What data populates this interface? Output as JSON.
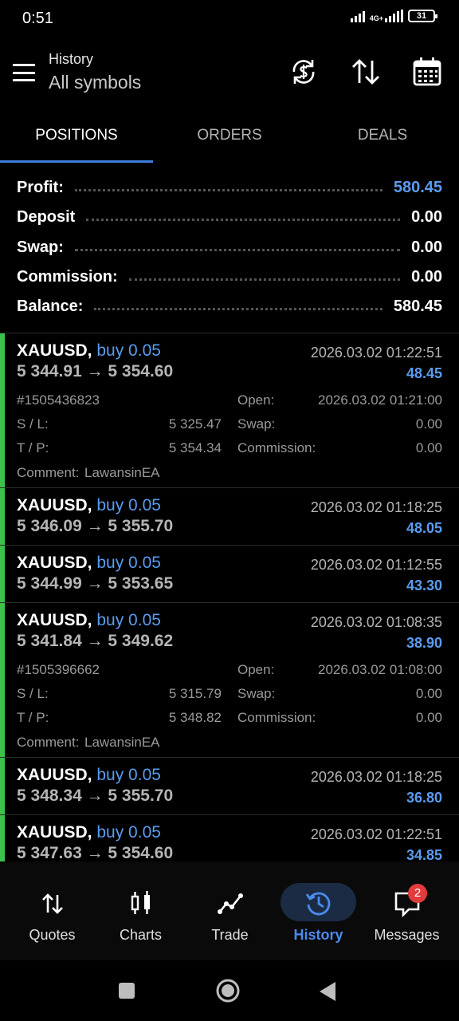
{
  "status": {
    "time": "0:51",
    "network": "4G+",
    "battery": "31"
  },
  "header": {
    "title": "History",
    "subtitle": "All symbols"
  },
  "tabs": [
    {
      "label": "POSITIONS"
    },
    {
      "label": "ORDERS"
    },
    {
      "label": "DEALS"
    }
  ],
  "summary": [
    {
      "label": "Profit:",
      "value": "580.45"
    },
    {
      "label": "Deposit",
      "value": "0.00"
    },
    {
      "label": "Swap:",
      "value": "0.00"
    },
    {
      "label": "Commission:",
      "value": "0.00"
    },
    {
      "label": "Balance:",
      "value": "580.45"
    }
  ],
  "positions": [
    {
      "symbol": "XAUUSD,",
      "side": "buy 0.05",
      "prices": "5 344.91 → 5 354.60",
      "time": "2026.03.02 01:22:51",
      "profit": "48.45",
      "ticket": "#1505436823",
      "open_label": "Open:",
      "open": "2026.03.02 01:21:00",
      "sl_label": "S / L:",
      "sl": "5 325.47",
      "swap_label": "Swap:",
      "swap": "0.00",
      "tp_label": "T / P:",
      "tp": "5 354.34",
      "commission_label": "Commission:",
      "commission": "0.00",
      "comment_label": "Comment:",
      "comment": "LawansinEA"
    },
    {
      "symbol": "XAUUSD,",
      "side": "buy 0.05",
      "prices": "5 346.09 → 5 355.70",
      "time": "2026.03.02 01:18:25",
      "profit": "48.05"
    },
    {
      "symbol": "XAUUSD,",
      "side": "buy 0.05",
      "prices": "5 344.99 → 5 353.65",
      "time": "2026.03.02 01:12:55",
      "profit": "43.30"
    },
    {
      "symbol": "XAUUSD,",
      "side": "buy 0.05",
      "prices": "5 341.84 → 5 349.62",
      "time": "2026.03.02 01:08:35",
      "profit": "38.90",
      "ticket": "#1505396662",
      "open_label": "Open:",
      "open": "2026.03.02 01:08:00",
      "sl_label": "S / L:",
      "sl": "5 315.79",
      "swap_label": "Swap:",
      "swap": "0.00",
      "tp_label": "T / P:",
      "tp": "5 348.82",
      "commission_label": "Commission:",
      "commission": "0.00",
      "comment_label": "Comment:",
      "comment": "LawansinEA"
    },
    {
      "symbol": "XAUUSD,",
      "side": "buy 0.05",
      "prices": "5 348.34 → 5 355.70",
      "time": "2026.03.02 01:18:25",
      "profit": "36.80"
    },
    {
      "symbol": "XAUUSD,",
      "side": "buy 0.05",
      "prices": "5 347.63 → 5 354.60",
      "time": "2026.03.02 01:22:51",
      "profit": "34.85"
    }
  ],
  "nav": [
    {
      "label": "Quotes",
      "icon": "quotes-icon"
    },
    {
      "label": "Charts",
      "icon": "charts-icon"
    },
    {
      "label": "Trade",
      "icon": "trade-icon"
    },
    {
      "label": "History",
      "icon": "history-icon"
    },
    {
      "label": "Messages",
      "icon": "messages-icon"
    }
  ],
  "messages_badge": "2",
  "colors": {
    "accent": "#3d7fe0",
    "profit": "#5b9cf0",
    "buy_bar": "#3cc24a",
    "background": "#000000"
  }
}
